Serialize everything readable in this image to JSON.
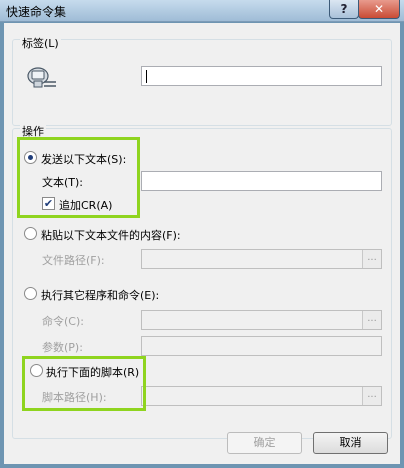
{
  "window": {
    "title": "快速命令集",
    "help_glyph": "?",
    "close_glyph": "✕"
  },
  "label_group": {
    "legend": "标签(L)",
    "icon": "computer-network-icon",
    "value": ""
  },
  "operation_group": {
    "legend": "操作",
    "send_text": {
      "label": "发送以下文本(S):",
      "selected": true,
      "text_label": "文本(T):",
      "text_value": "",
      "append_cr_label": "追加CR(A)",
      "append_cr_checked": true
    },
    "paste_file": {
      "label": "粘贴以下文本文件的内容(F):",
      "selected": false,
      "path_label": "文件路径(F):",
      "path_value": "",
      "browse": "..."
    },
    "run_program": {
      "label": "执行其它程序和命令(E):",
      "selected": false,
      "command_label": "命令(C):",
      "command_value": "",
      "browse": "...",
      "params_label": "参数(P):",
      "params_value": ""
    },
    "run_script": {
      "label": "执行下面的脚本(R)",
      "selected": false,
      "path_label": "脚本路径(H):",
      "path_value": "",
      "browse": "..."
    }
  },
  "buttons": {
    "ok": "确定",
    "cancel": "取消"
  },
  "colors": {
    "highlight": "#8fd41f",
    "titlebar": "#b3cde3"
  }
}
